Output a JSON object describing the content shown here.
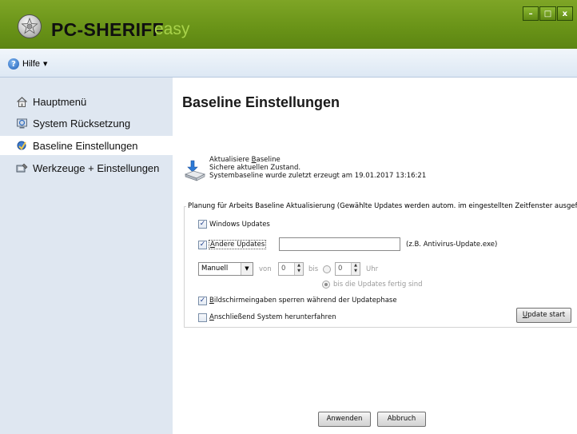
{
  "window": {
    "app_name": "PC-SHERIFF",
    "app_edition": "easy",
    "controls": {
      "minimize": "–",
      "maximize": "□",
      "close": "x"
    }
  },
  "menubar": {
    "help": "Hilfe",
    "help_caret": "▼"
  },
  "sidebar": {
    "items": [
      {
        "label": "Hauptmenü",
        "icon": "home-icon",
        "active": false
      },
      {
        "label": "System Rücksetzung",
        "icon": "restore-icon",
        "active": false
      },
      {
        "label": "Baseline Einstellungen",
        "icon": "baseline-icon",
        "active": true
      },
      {
        "label": "Werkzeuge + Einstellungen",
        "icon": "tools-icon",
        "active": false
      }
    ]
  },
  "main": {
    "title": "Baseline Einstellungen",
    "baseline_info": {
      "action_prefix": "Aktualisiere ",
      "action_underlined": "B",
      "action_suffix": "aseline",
      "line2": "Sichere aktuellen Zustand.",
      "line3": "Systembaseline wurde zuletzt erzeugt am 19.01.2017 13:16:21"
    },
    "planning": {
      "legend": "Planung für Arbeits Baseline Aktualisierung  (Gewählte Updates werden autom. im eingestellten Zeitfenster ausgeführt)",
      "windows_updates": {
        "label": "Windows Updates",
        "checked": true
      },
      "other_updates": {
        "underlined": "A",
        "rest": "ndere Updates",
        "checked": true
      },
      "exe_input": {
        "value": "",
        "hint": "(z.B. Antivirus-Update.exe)"
      },
      "schedule": {
        "mode": "Manuell",
        "von": "von",
        "from_value": "0",
        "bis": "bis",
        "to_value": "0",
        "uhr": "Uhr",
        "until_done": "bis die Updates fertig sind"
      },
      "lock_input": {
        "underlined": "B",
        "rest": "ildschirmeingaben sperren während der Updatephase",
        "checked": true
      },
      "shutdown": {
        "underlined": "A",
        "rest": "nschließend System herunterfahren",
        "checked": false
      },
      "update_start": {
        "underlined": "U",
        "rest": "pdate start"
      }
    },
    "buttons": {
      "apply": "Anwenden",
      "cancel": "Abbruch"
    }
  },
  "colors": {
    "titlebar": "#6a9418",
    "edition": "#a8d24a",
    "sidebar_bg": "#dfe7f1",
    "menubar_bg": "#e6eef7"
  }
}
